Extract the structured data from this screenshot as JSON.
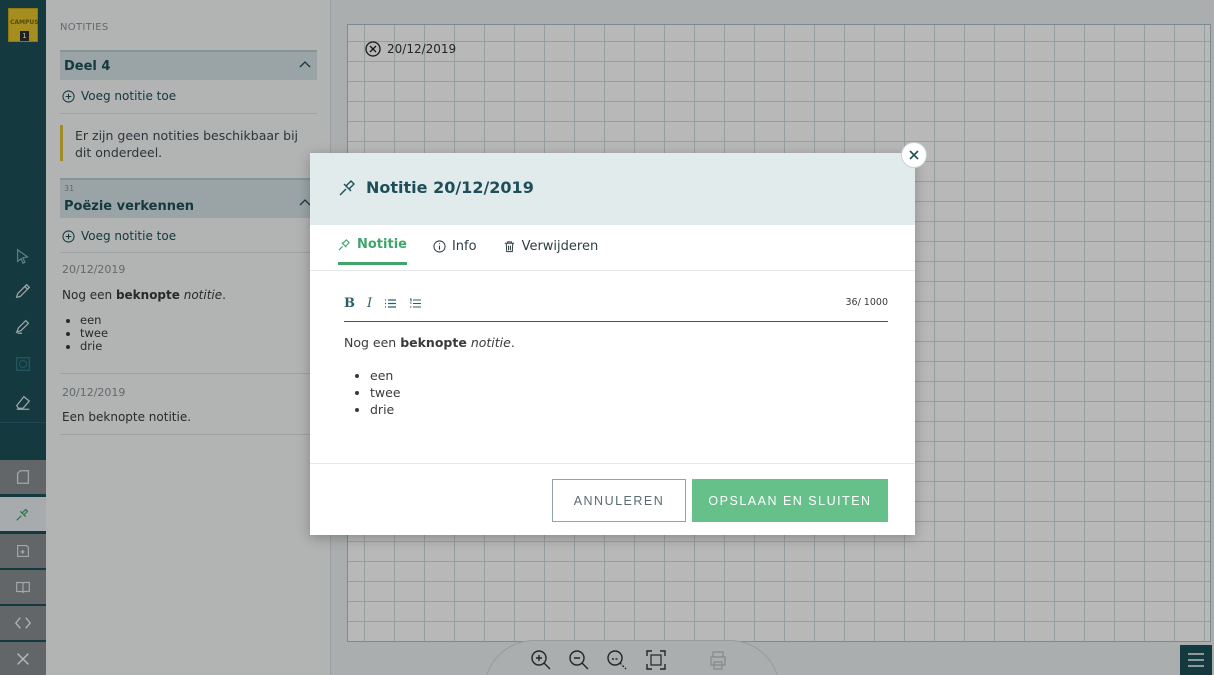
{
  "app": {
    "logo_text": "CAMPUS",
    "logo_number": "1"
  },
  "panel": {
    "title": "NOTITIES",
    "section1": {
      "title": "Deel 4",
      "add_label": "Voeg notitie toe",
      "empty_message": "Er zijn geen notities beschikbaar bij dit onderdeel."
    },
    "section2": {
      "number": "31",
      "title": "Poëzie verkennen",
      "add_label": "Voeg notitie toe",
      "notes": [
        {
          "date": "20/12/2019",
          "text_start": "Nog een ",
          "text_bold": "beknopte",
          "text_italic": "notitie",
          "text_end": ".",
          "items": [
            "een",
            "twee",
            "drie"
          ]
        },
        {
          "date": "20/12/2019",
          "text": "Een beknopte notitie."
        }
      ]
    }
  },
  "page": {
    "date_label": "20/12/2019"
  },
  "modal": {
    "title": "Notitie 20/12/2019",
    "tabs": [
      {
        "label": "Notitie",
        "active": true
      },
      {
        "label": "Info",
        "active": false
      },
      {
        "label": "Verwijderen",
        "active": false
      }
    ],
    "counter": "36/ 1000",
    "editor": {
      "text_start": "Nog een ",
      "text_bold": "beknopte",
      "text_italic": "notitie",
      "text_end": ".",
      "items": [
        "een",
        "twee",
        "drie"
      ]
    },
    "cancel_label": "ANNULEREN",
    "save_label": "OPSLAAN EN SLUITEN"
  },
  "colors": {
    "toolbar": "#1d4f58",
    "accent_green": "#66c08a",
    "tab_active": "#3fa56a",
    "note_border": "#e0c03a"
  },
  "icons": {
    "toolbar": [
      "select-arrow-icon",
      "pencil-icon",
      "marker-icon",
      "ruler-icon",
      "eraser-icon",
      "page-icon",
      "pin-icon",
      "export-icon",
      "book-icon",
      "code-arrows-icon",
      "close-icon"
    ],
    "zoom": [
      "zoom-in-icon",
      "zoom-out-icon",
      "zoom-area-icon",
      "fit-page-icon",
      "print-icon"
    ]
  }
}
